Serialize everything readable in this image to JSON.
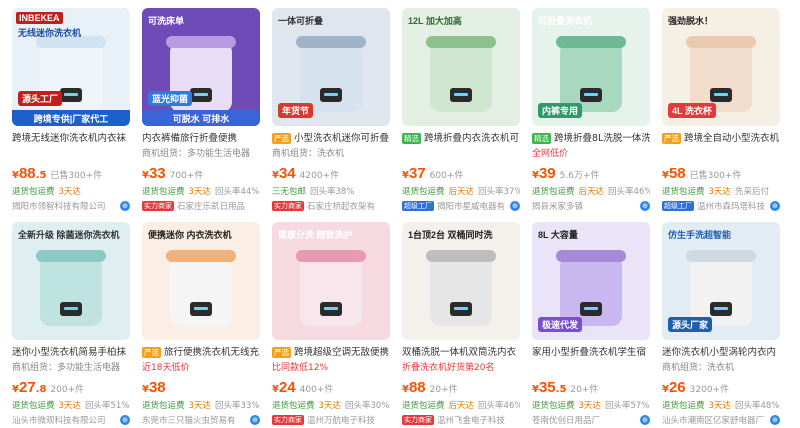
{
  "colors": {
    "price": "#ff5000",
    "accent_red": "#e4393c",
    "service_green": "#3a9a3a",
    "link_blue": "#2f86e8"
  },
  "products": [
    {
      "img": {
        "bg": "#e8f1f7",
        "body": "#eef6fb",
        "lid": "#cfe3f0",
        "brand": "INBEKEA",
        "headline": "无线迷你洗衣机",
        "headline_color": "#1a4aa0",
        "tag": "源头工厂",
        "tag_bg": "#c21e1e",
        "bottom": "跨境专供|厂家代工",
        "bottom_bg": "#1e5fc9"
      },
      "title": "跨境无线迷你洗衣机内衣袜",
      "title_hl": "迷你洗衣机",
      "title_tag": "",
      "sub": "",
      "sub_class": "",
      "price": "88",
      "price_dec": ".5",
      "sold": "已售300+件",
      "svc": [
        "退货包运费",
        "3天达"
      ],
      "svc_extra": "",
      "shop": "揭阳市领智科技有限公司",
      "shop_badge": "",
      "shop_globe": true
    },
    {
      "img": {
        "bg": "#6f4bb7",
        "body": "#e7ddf6",
        "lid": "#b79be0",
        "brand": "",
        "headline": "可洗床单",
        "headline_color": "#ffffff",
        "tag": "蓝光抑菌",
        "tag_bg": "#2d7be0",
        "bottom": "可脱水 可排水",
        "bottom_bg": "#3a64d8"
      },
      "title": "内衣裤備旅行折叠便携",
      "title_hl": "",
      "title_tag": "",
      "sub": "商机组货：多功能生活电器",
      "sub_class": "",
      "price": "33",
      "price_dec": "",
      "sold": "700+件",
      "svc": [
        "退货包运费",
        "3天达"
      ],
      "svc_extra": "回头率44%",
      "shop": "石家庄乐凯日用品",
      "shop_badge": "实力商家",
      "shop_globe": false
    },
    {
      "img": {
        "bg": "#dfe6ee",
        "body": "#d6e2ee",
        "lid": "#9fb4c9",
        "brand": "",
        "headline": "一体可折叠",
        "headline_color": "#333333",
        "tag": "年货节",
        "tag_bg": "#d43b2c",
        "bottom": "",
        "bottom_bg": ""
      },
      "title": "小型洗衣机迷你可折叠",
      "title_hl": "洗衣机",
      "title_tag": "严选",
      "sub": "商机组货：洗衣机",
      "sub_class": "",
      "price": "34",
      "price_dec": "",
      "sold": "4200+件",
      "svc": [
        "三无包邮"
      ],
      "svc_extra": "回头率38%",
      "shop": "石家庄桥起衣架有",
      "shop_badge": "实力商家",
      "shop_globe": false
    },
    {
      "img": {
        "bg": "#e3efe2",
        "body": "#cfe7cf",
        "lid": "#8cc08c",
        "brand": "",
        "headline": "12L 加大加高",
        "headline_color": "#2e6b2e",
        "tag": "",
        "tag_bg": "",
        "bottom": "",
        "bottom_bg": ""
      },
      "title": "跨境折叠内衣洗衣机可",
      "title_hl": "",
      "title_tag": "精选",
      "sub": "",
      "sub_class": "",
      "price": "37",
      "price_dec": "",
      "sold": "600+件",
      "svc": [
        "退货包运费",
        "后天达"
      ],
      "svc_extra": "回头率37%",
      "shop": "揭阳市星威电器有",
      "shop_badge": "超级工厂",
      "shop_globe": true
    },
    {
      "img": {
        "bg": "#e6f2ec",
        "body": "#a8d9c0",
        "lid": "#6fb896",
        "brand": "",
        "headline": "可折叠洗衣机",
        "headline_color": "#ffffff",
        "tag": "内裤专用",
        "tag_bg": "#2e9a6a",
        "bottom": "",
        "bottom_bg": ""
      },
      "title": "跨境折叠8L洗脱一体洗",
      "title_hl": "洗",
      "title_tag": "精选",
      "sub": "全网低价",
      "sub_class": "red",
      "price": "39",
      "price_dec": "",
      "sold": "5.6万+件",
      "svc": [
        "退货包运费",
        "后天达"
      ],
      "svc_extra": "回头率46%",
      "shop": "揭县米家多镇",
      "shop_badge": "",
      "shop_globe": true
    },
    {
      "img": {
        "bg": "#f6efe4",
        "body": "#f2dccb",
        "lid": "#e9c9b0",
        "brand": "",
        "headline": "强劲脱水！",
        "headline_color": "#222222",
        "tag": "4L 洗衣杯",
        "tag_bg": "#e4393c",
        "bottom": "",
        "bottom_bg": ""
      },
      "title": "跨境全自动小型洗衣机",
      "title_hl": "洗衣机",
      "title_tag": "严选",
      "sub": "",
      "sub_class": "",
      "price": "58",
      "price_dec": "",
      "sold": "已售300+件",
      "svc": [
        "退货包运费",
        "3天达"
      ],
      "svc_extra": "先采后付",
      "shop": "温州市森玛塔科技",
      "shop_badge": "超级工厂",
      "shop_globe": true
    },
    {
      "img": {
        "bg": "#dfeef0",
        "body": "#bfe3e0",
        "lid": "#8cc9c4",
        "brand": "",
        "headline": "全新升级 除菌迷你洗衣机",
        "headline_color": "#333333",
        "tag": "",
        "tag_bg": "",
        "bottom": "",
        "bottom_bg": ""
      },
      "title": "迷你小型洗衣机简易手柏抹",
      "title_hl": "",
      "title_tag": "",
      "sub": "商机组货：多功能生活电器",
      "sub_class": "",
      "price": "27",
      "price_dec": ".8",
      "sold": "200+件",
      "svc": [
        "退货包运费",
        "3天达"
      ],
      "svc_extra": "回头率51%",
      "shop": "汕头市微观科技有限公司",
      "shop_badge": "",
      "shop_globe": true
    },
    {
      "img": {
        "bg": "#fbeee4",
        "body": "#f5f5f5",
        "lid": "#f0b27a",
        "brand": "",
        "headline": "便携迷你 内衣洗衣机",
        "headline_color": "#222222",
        "tag": "",
        "tag_bg": "",
        "bottom": "",
        "bottom_bg": ""
      },
      "title": "旅行便携洗衣机无线充",
      "title_hl": "",
      "title_tag": "严选",
      "sub": "近18天低价",
      "sub_class": "red",
      "price": "38",
      "price_dec": "",
      "sold": "",
      "svc": [
        "退货包运费",
        "3天达"
      ],
      "svc_extra": "回头率33%",
      "shop": "东莞市三只猫火虫贸易有",
      "shop_badge": "",
      "shop_globe": true
    },
    {
      "img": {
        "bg": "#f7d9e2",
        "body": "#f9e6ec",
        "lid": "#e79bb2",
        "brand": "",
        "headline": "健康分洗 精致洗护",
        "headline_color": "#ffffff",
        "tag": "",
        "tag_bg": "",
        "bottom": "",
        "bottom_bg": ""
      },
      "title": "跨境超级空调无敌便携",
      "title_hl": "",
      "title_tag": "严选",
      "sub": "比同款低12%",
      "sub_class": "red",
      "price": "24",
      "price_dec": "",
      "sold": "400+件",
      "svc": [
        "退货包运费",
        "3天达"
      ],
      "svc_extra": "回头率30%",
      "shop": "温州万航电子科技",
      "shop_badge": "实力商家",
      "shop_globe": false
    },
    {
      "img": {
        "bg": "#f4f1ec",
        "body": "#e6e6e6",
        "lid": "#bdbdbd",
        "brand": "",
        "headline": "1台顶2台 双桶同时洗",
        "headline_color": "#222222",
        "tag": "",
        "tag_bg": "",
        "bottom": "",
        "bottom_bg": ""
      },
      "title": "双桶洗脱一体机双筒洗内衣",
      "title_hl": "",
      "title_tag": "",
      "sub": "折叠洗衣机好货第20名",
      "sub_class": "red",
      "price": "88",
      "price_dec": "",
      "sold": "20+件",
      "svc": [
        "退货包运费",
        "后天达"
      ],
      "svc_extra": "回头率46%",
      "shop": "温州飞金电子科技",
      "shop_badge": "实力商家",
      "shop_globe": false
    },
    {
      "img": {
        "bg": "#e9e4f7",
        "body": "#c9b8ef",
        "lid": "#a48ad9",
        "brand": "",
        "headline": "8L 大容量",
        "headline_color": "#222222",
        "tag": "极速代发",
        "tag_bg": "#7a4fd0",
        "bottom": "",
        "bottom_bg": ""
      },
      "title": "家用小型折叠洗衣机学生宿",
      "title_hl": "",
      "title_tag": "",
      "sub": "",
      "sub_class": "",
      "price": "35",
      "price_dec": ".5",
      "sold": "20+件",
      "svc": [
        "退货包运费",
        "3天达"
      ],
      "svc_extra": "回头率57%",
      "shop": "苍南优创日用品厂",
      "shop_badge": "",
      "shop_globe": true
    },
    {
      "img": {
        "bg": "#e2ecf3",
        "body": "#f2f2f2",
        "lid": "#cfd9e2",
        "brand": "",
        "headline": "仿生手洗超智能",
        "headline_color": "#1f5fae",
        "tag": "源头厂家",
        "tag_bg": "#1f5fae",
        "bottom": "",
        "bottom_bg": ""
      },
      "title": "迷你洗衣机小型涡轮内衣内",
      "title_hl": "迷你洗衣机",
      "title_tag": "",
      "sub": "商机组货：洗衣机",
      "sub_class": "",
      "price": "26",
      "price_dec": "",
      "sold": "3200+件",
      "svc": [
        "退货包运费",
        "3天达"
      ],
      "svc_extra": "回头率48%",
      "shop": "汕头市潮南区亿家舒电器厂",
      "shop_badge": "",
      "shop_globe": true
    }
  ]
}
